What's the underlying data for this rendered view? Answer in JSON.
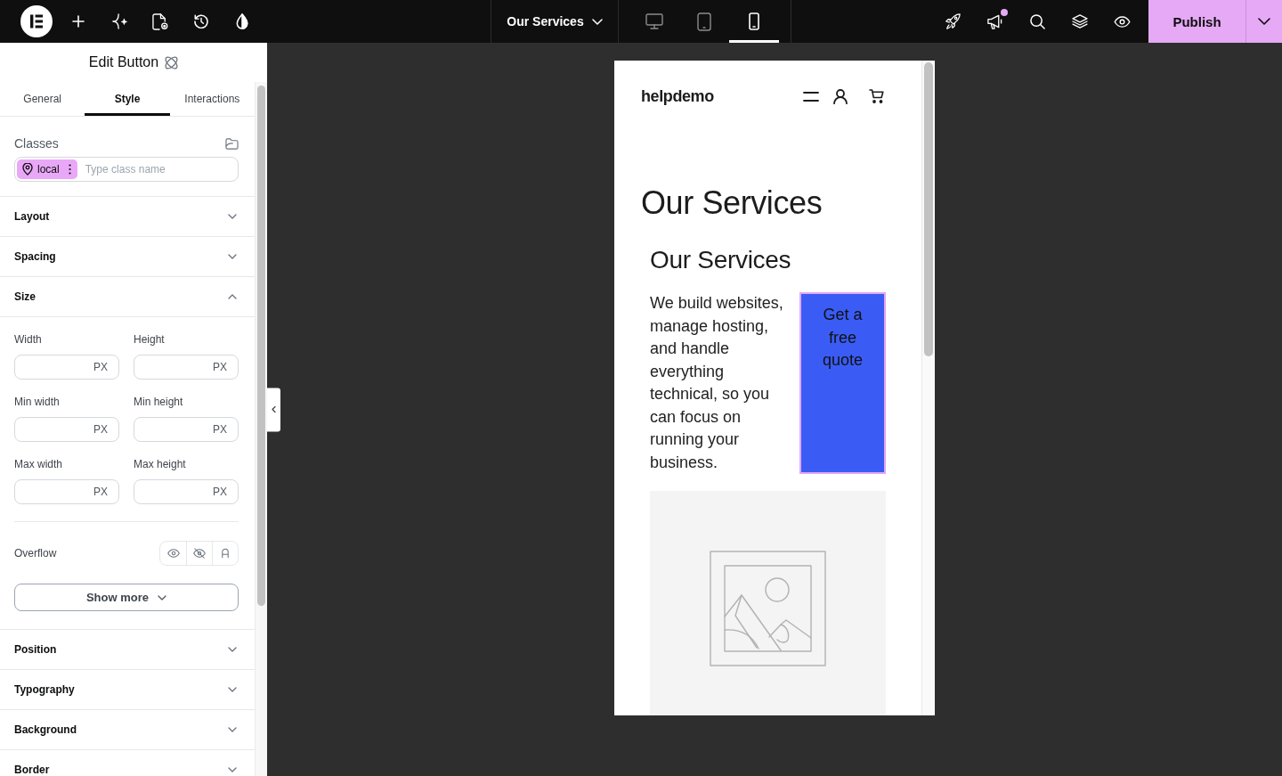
{
  "topbar": {
    "page_title": "Our Services",
    "devices": [
      {
        "kind": "desktop",
        "selected": false
      },
      {
        "kind": "tablet",
        "selected": false
      },
      {
        "kind": "mobile",
        "selected": true
      }
    ],
    "notification": true,
    "publish": "Publish"
  },
  "panel": {
    "title": "Edit Button",
    "tabs": [
      {
        "label": "General",
        "selected": false
      },
      {
        "label": "Style",
        "selected": true
      },
      {
        "label": "Interactions",
        "selected": false
      }
    ],
    "classes": {
      "label": "Classes",
      "chip": "local",
      "placeholder": "Type class name"
    },
    "sections": [
      {
        "title": "Layout",
        "expanded": false
      },
      {
        "title": "Spacing",
        "expanded": false
      },
      {
        "title": "Size",
        "expanded": true,
        "fields": [
          {
            "label": "Width",
            "unit": "PX"
          },
          {
            "label": "Height",
            "unit": "PX"
          },
          {
            "label": "Min width",
            "unit": "PX"
          },
          {
            "label": "Min height",
            "unit": "PX"
          },
          {
            "label": "Max width",
            "unit": "PX"
          },
          {
            "label": "Max height",
            "unit": "PX"
          }
        ],
        "overflow_label": "Overflow",
        "show_more": "Show more"
      },
      {
        "title": "Position",
        "expanded": false
      },
      {
        "title": "Typography",
        "expanded": false
      },
      {
        "title": "Background",
        "expanded": false
      },
      {
        "title": "Border",
        "expanded": false
      }
    ]
  },
  "preview": {
    "logo": "helpdemo",
    "heading": "Our Services",
    "subheading": "Our Services",
    "paragraph": "We build websites, manage hosting, and handle everything technical, so you can focus on running your business.",
    "button": {
      "label": "Get a free quote",
      "selected": true
    }
  }
}
